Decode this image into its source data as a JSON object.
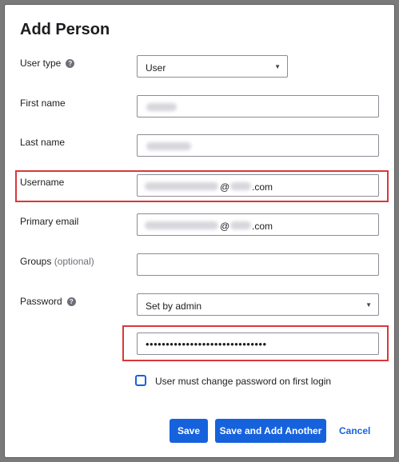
{
  "dialog": {
    "title": "Add Person"
  },
  "fields": {
    "user_type": {
      "label": "User type",
      "value": "User"
    },
    "first_name": {
      "label": "First name"
    },
    "last_name": {
      "label": "Last name"
    },
    "username": {
      "label": "Username",
      "domain_at": "@",
      "domain_tld": ".com"
    },
    "primary_email": {
      "label": "Primary email",
      "domain_at": "@",
      "domain_tld": ".com"
    },
    "groups": {
      "label": "Groups",
      "optional_label": "(optional)",
      "value": ""
    },
    "password": {
      "label": "Password",
      "mode_value": "Set by admin",
      "masked_value": "••••••••••••••••••••••••••••••"
    }
  },
  "checkbox": {
    "label": "User must change password on first login",
    "checked": false
  },
  "buttons": {
    "save": "Save",
    "save_add": "Save and Add Another",
    "cancel": "Cancel"
  },
  "icons": {
    "help": "?",
    "caret": "▼"
  },
  "colors": {
    "primary": "#1662dd",
    "highlight": "#d9383a"
  }
}
